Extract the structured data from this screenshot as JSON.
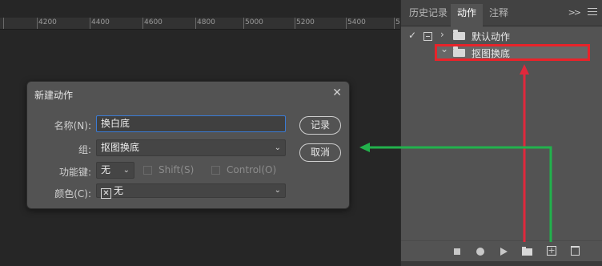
{
  "ruler": {
    "ticks": [
      "4200",
      "4400",
      "4600",
      "4800",
      "5000",
      "5200",
      "5400",
      "5"
    ]
  },
  "panel": {
    "tabs": [
      "历史记录",
      "动作",
      "注释"
    ],
    "more_glyph": ">>",
    "rows": [
      {
        "label": "默认动作",
        "chevron": "›",
        "checked_glyph": "✓"
      },
      {
        "label": "抠图换底",
        "chevron": "⌄"
      }
    ]
  },
  "dialog": {
    "title": "新建动作",
    "close_glyph": "✕",
    "name_label": "名称(N):",
    "name_value": "换白底",
    "group_label": "组:",
    "group_value": "抠图换底",
    "fkey_label": "功能键:",
    "fkey_value": "无",
    "shift_label": "Shift(S)",
    "control_label": "Control(O)",
    "color_label": "颜色(C):",
    "color_value": "无",
    "record_button": "记录",
    "cancel_button": "取消"
  },
  "colors": {
    "highlight_red": "#e8232a",
    "arrow_red": "#e0283c",
    "arrow_green": "#22b14c"
  }
}
